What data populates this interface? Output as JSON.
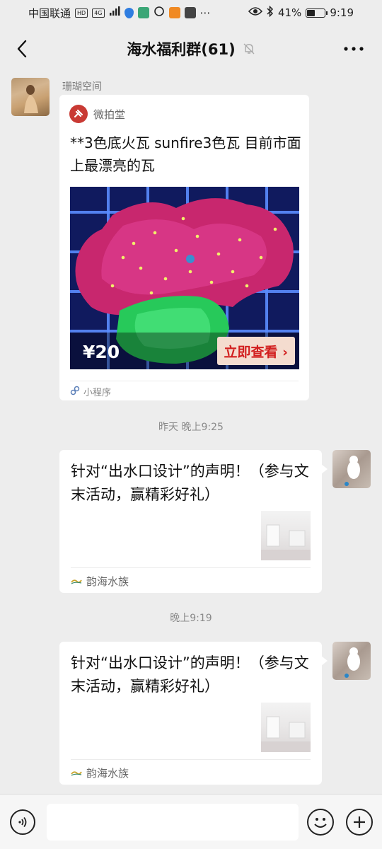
{
  "status_bar": {
    "carrier": "中国联通",
    "hd_label": "HD",
    "network_label": "4G",
    "battery": "41%",
    "time": "9:19"
  },
  "header": {
    "title": "海水福利群(61)"
  },
  "messages": [
    {
      "sender": "珊瑚空间",
      "mini_program": {
        "app_name": "微拍堂",
        "title": "**3色底火瓦 sunfire3色瓦  目前市面上最漂亮的瓦",
        "price": "¥20",
        "cta": "立即查看 ›",
        "footer": "小程序"
      }
    },
    {
      "timestamp": "昨天 晚上9:25",
      "article": {
        "title": "针对“出水口设计”的声明！（参与文末活动，赢精彩好礼）",
        "source": "韵海水族"
      }
    },
    {
      "timestamp": "晚上9:19",
      "article": {
        "title": "针对“出水口设计”的声明！（参与文末活动，赢精彩好礼）",
        "source": "韵海水族"
      }
    }
  ],
  "input_bar": {
    "placeholder": ""
  },
  "colors": {
    "background": "#ededed",
    "bubble": "#ffffff",
    "cta_text": "#d21f1f",
    "cta_bg": "#f4dccf"
  }
}
